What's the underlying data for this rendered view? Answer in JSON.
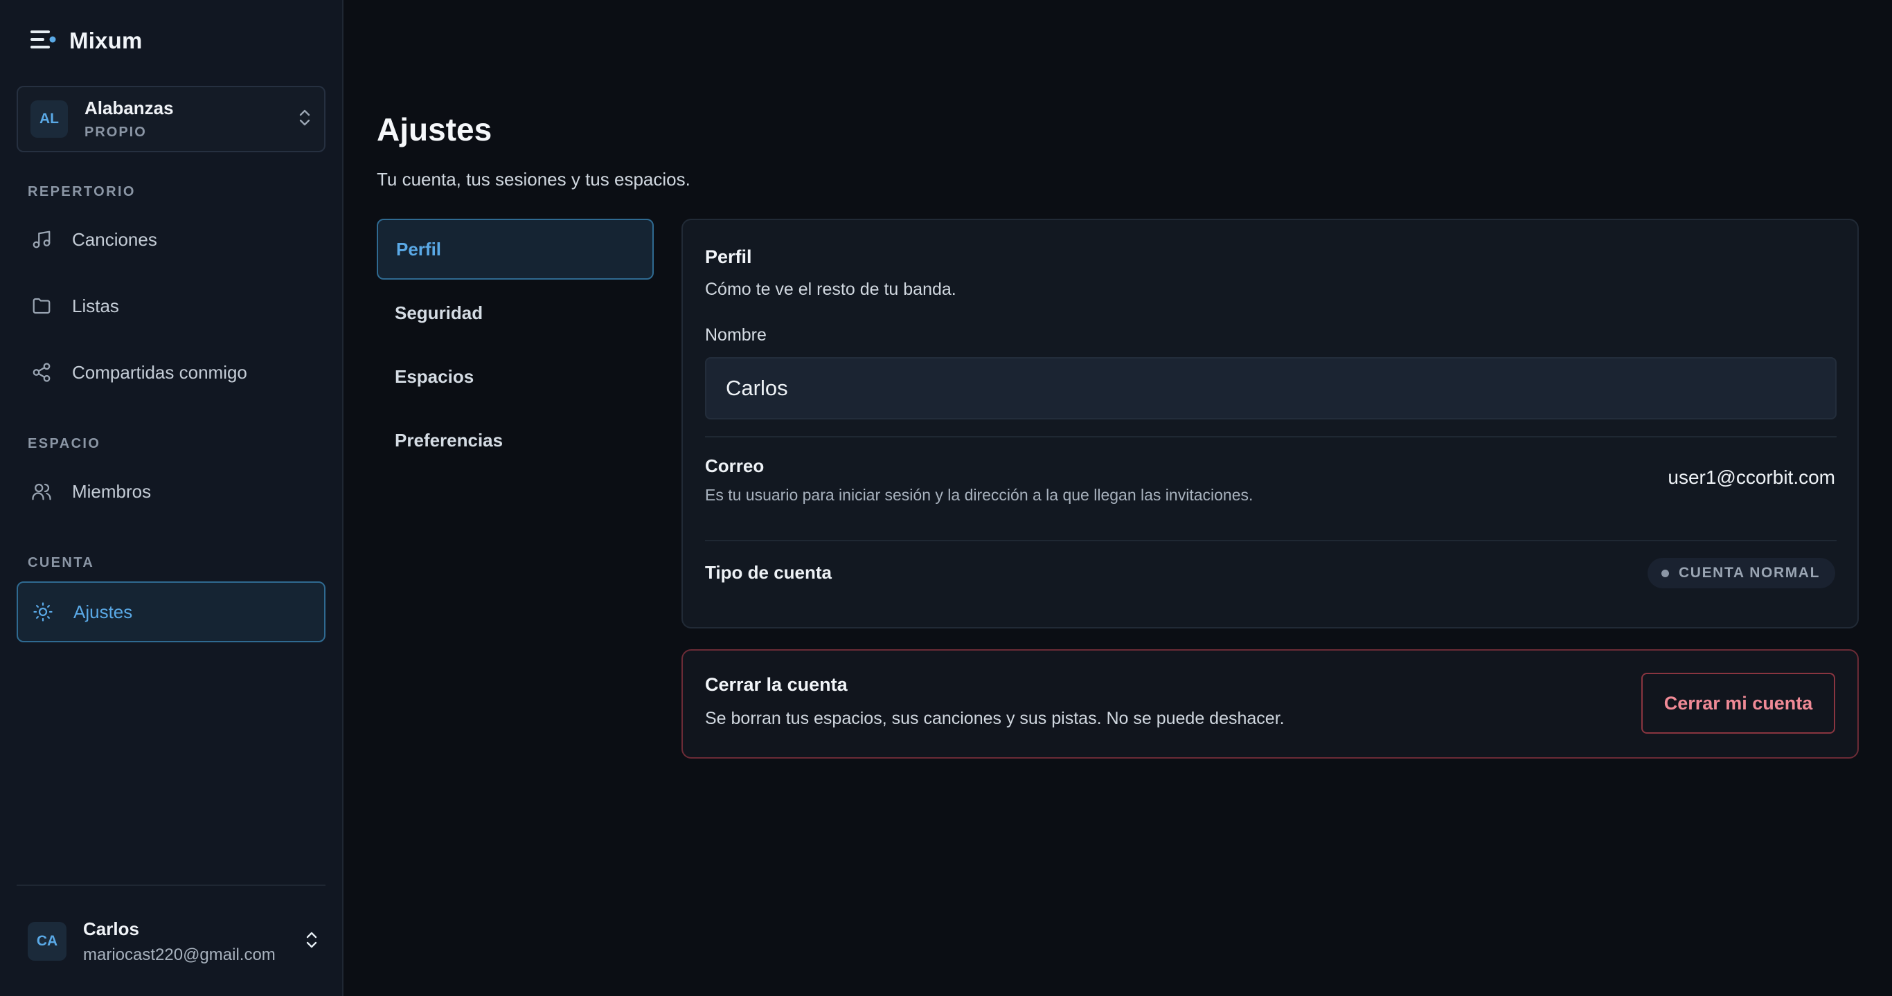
{
  "app": {
    "name": "Mixum"
  },
  "workspace": {
    "initials": "AL",
    "name": "Alabanzas",
    "role": "PROPIO"
  },
  "sidebar": {
    "sections": [
      {
        "label": "REPERTORIO",
        "items": [
          {
            "label": "Canciones",
            "icon": "music-note-icon"
          },
          {
            "label": "Listas",
            "icon": "folder-icon"
          },
          {
            "label": "Compartidas conmigo",
            "icon": "share-icon"
          }
        ]
      },
      {
        "label": "ESPACIO",
        "items": [
          {
            "label": "Miembros",
            "icon": "users-icon"
          }
        ]
      },
      {
        "label": "CUENTA",
        "items": [
          {
            "label": "Ajustes",
            "icon": "sun-settings-icon",
            "active": true
          }
        ]
      }
    ]
  },
  "user": {
    "initials": "CA",
    "name": "Carlos",
    "email": "mariocast220@gmail.com"
  },
  "page": {
    "title": "Ajustes",
    "subtitle": "Tu cuenta, tus sesiones y tus espacios."
  },
  "tabs": [
    {
      "label": "Perfil",
      "active": true
    },
    {
      "label": "Seguridad"
    },
    {
      "label": "Espacios"
    },
    {
      "label": "Preferencias"
    }
  ],
  "profile": {
    "title": "Perfil",
    "description": "Cómo te ve el resto de tu banda.",
    "name_label": "Nombre",
    "name_value": "Carlos",
    "email_label": "Correo",
    "email_description": "Es tu usuario para iniciar sesión y la dirección a la que llegan las invitaciones.",
    "email_value": "user1@ccorbit.com",
    "account_type_label": "Tipo de cuenta",
    "account_type_value": "CUENTA NORMAL"
  },
  "danger": {
    "title": "Cerrar la cuenta",
    "description": "Se borran tus espacios, sus canciones y sus pistas. No se puede deshacer.",
    "button_label": "Cerrar mi cuenta"
  },
  "colors": {
    "accent": "#5aa9e6",
    "danger": "#f08a96",
    "background": "#0b0e14",
    "sidebar": "#111722"
  }
}
